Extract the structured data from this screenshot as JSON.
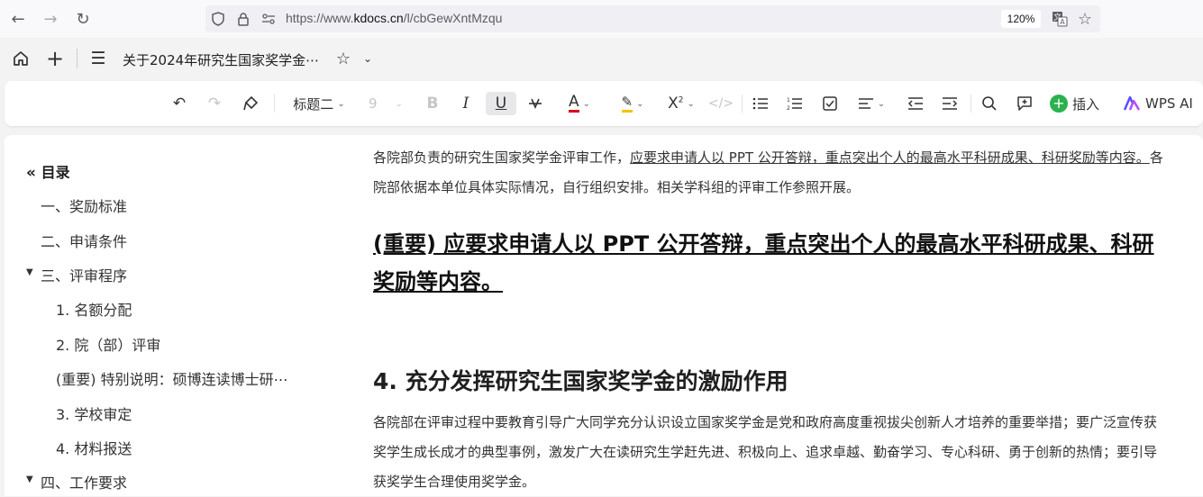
{
  "browser": {
    "url_prefix": "https://www.",
    "url_domain": "kdocs.cn",
    "url_path": "/l/cbGewXntMzqu",
    "zoom": "120%"
  },
  "app": {
    "doc_title": "关于2024年研究生国家奖学金⋯"
  },
  "toolbar": {
    "style_select": "标题二",
    "font_size": "9",
    "insert_label": "插入",
    "wps_ai_label": "WPS AI"
  },
  "toc": {
    "title": "目录",
    "items": [
      {
        "label": "一、奖励标准"
      },
      {
        "label": "二、申请条件"
      },
      {
        "label": "三、评审程序"
      },
      {
        "label": "1. 名额分配"
      },
      {
        "label": "2. 院（部）评审"
      },
      {
        "label": "(重要) 特别说明：硕博连读博士研⋯"
      },
      {
        "label": "3. 学校审定"
      },
      {
        "label": "4. 材料报送"
      },
      {
        "label": "四、工作要求"
      }
    ]
  },
  "doc": {
    "p1_start": "各院部负责的研究生国家奖学金评审工作，",
    "p1_underlined": "应要求申请人以 PPT 公开答辩，重点突出个人的最高水平科研成果、科研奖励等内容。",
    "p1_end": "各院部依据本单位具体实际情况，自行组织安排。相关学科组的评审工作参照开展。",
    "important_heading": "(重要) 应要求申请人以 PPT 公开答辩，重点突出个人的最高水平科研成果、科研奖励等内容。",
    "section4_heading": "4. 充分发挥研究生国家奖学金的激励作用",
    "p2": "各院部在评审过程中要教育引导广大同学充分认识设立国家奖学金是党和政府高度重视拔尖创新人才培养的重要举措；要广泛宣传获奖学生成长成才的典型事例，激发广大在读研究生学赶先进、积极向上、追求卓越、勤奋学习、专心科研、勇于创新的热情；要引导获奖学生合理使用奖学金。"
  }
}
